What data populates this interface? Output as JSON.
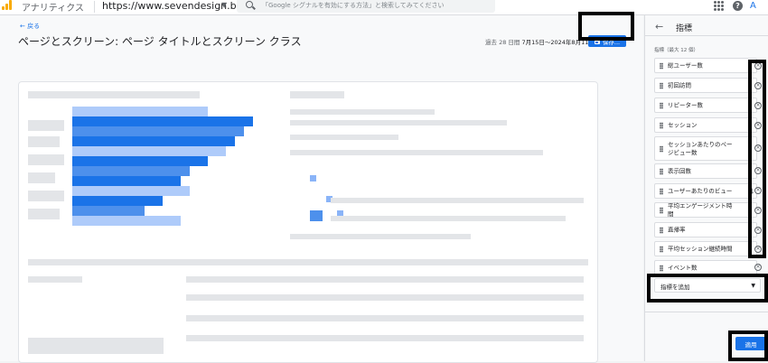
{
  "header": {
    "app_name": "アナリティクス",
    "property": "https://www.sevendesign.bi...",
    "search_placeholder": "「Google シグナルを有効にする方法」と検索してみてください",
    "help_glyph": "?",
    "account_glyph": "A"
  },
  "main": {
    "back_label": "戻る",
    "title": "ページとスクリーン: ページ タイトルとスクリーン クラス",
    "date_prefix": "過去 28 日間",
    "date_range": "7月15日～2024年8月11日",
    "save_label": "保存..."
  },
  "panel": {
    "title": "指標",
    "subtitle": "指標（最大 12 個）",
    "metrics": [
      "総ユーザー数",
      "初回訪問",
      "リピーター数",
      "セッション",
      "セッションあたりのページビュー数",
      "表示回数",
      "ユーザーあたりのビュー",
      "平均エンゲージメント時間",
      "直帰率",
      "平均セッション継続時間",
      "イベント数"
    ],
    "add_metric_label": "指標を追加",
    "apply_label": "適用",
    "remove_glyph": "×"
  },
  "colors": {
    "accent": "#1a73e8",
    "highlight_box": "#000000",
    "logo": "#f9ab00"
  }
}
